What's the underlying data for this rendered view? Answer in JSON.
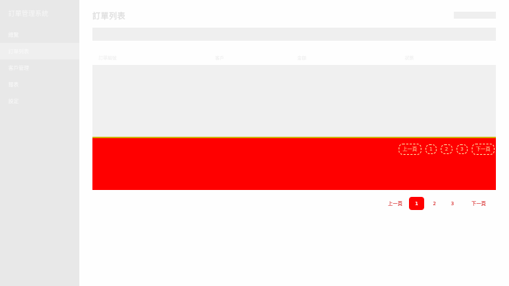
{
  "app": {
    "title": "訂單管理系統"
  },
  "sidebar": {
    "items": [
      {
        "label": "總覽"
      },
      {
        "label": "訂單列表"
      },
      {
        "label": "客戶管理"
      },
      {
        "label": "報表"
      },
      {
        "label": "設定"
      }
    ],
    "active_index": 1
  },
  "page": {
    "title": "訂單列表"
  },
  "table": {
    "columns": [
      {
        "label": "訂單編號"
      },
      {
        "label": "客戶"
      },
      {
        "label": "金額"
      },
      {
        "label": "狀態"
      }
    ]
  },
  "overlay_pager": {
    "prev": "上一頁",
    "pages": [
      "1",
      "2",
      "3"
    ],
    "next": "下一頁"
  },
  "pagination": {
    "prev": "上一頁",
    "pages": [
      "1",
      "2",
      "3"
    ],
    "current": "1",
    "next": "下一頁"
  },
  "colors": {
    "accent": "#ff0000",
    "sidebar_bg": "#e8e8e8",
    "placeholder_bg": "#efefef"
  }
}
